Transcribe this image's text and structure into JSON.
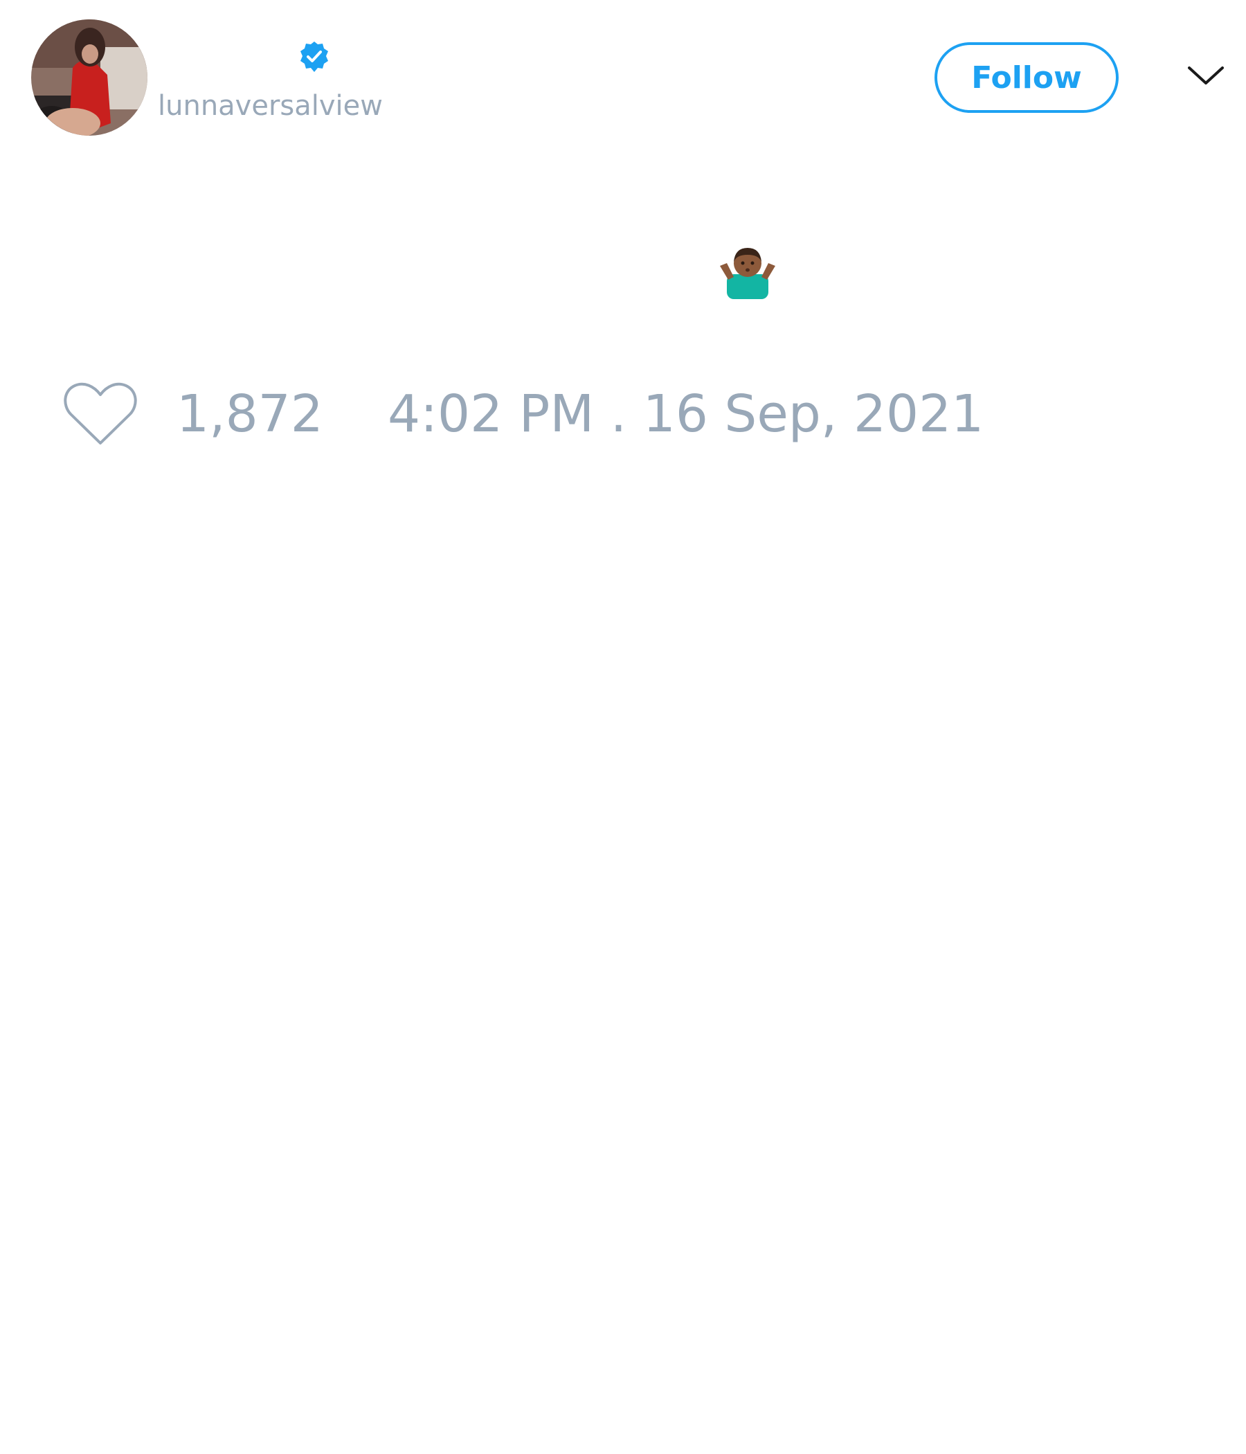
{
  "author": {
    "handle": "lunnaversalview",
    "verified_icon": "verified-badge-icon",
    "avatar": "profile-photo"
  },
  "header": {
    "follow_label": "Follow",
    "more_icon": "chevron-down-icon"
  },
  "tweet": {
    "emoji_icon": "person-shrugging-medium-dark-skin-emoji"
  },
  "footer": {
    "like_icon": "heart-outline-icon",
    "like_count": "1,872",
    "timestamp": "4:02 PM . 16 Sep, 2021"
  },
  "colors": {
    "accent": "#1da1f2",
    "muted_text": "#99a8b8",
    "background": "#ffffff"
  }
}
